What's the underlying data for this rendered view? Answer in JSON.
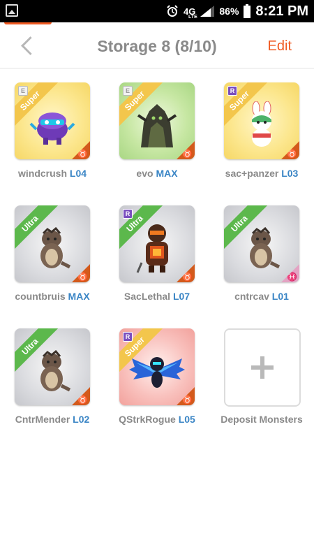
{
  "status_bar": {
    "network": "4G",
    "network_sub": "LTE",
    "battery": "86%",
    "time": "8:21 PM"
  },
  "header": {
    "title": "Storage 8 (8/10)",
    "edit_label": "Edit"
  },
  "monsters": [
    {
      "name": "windcrush",
      "level": "L04",
      "rarity": "Super",
      "badge": "E",
      "element": "♉",
      "bg_color": "#f6d766"
    },
    {
      "name": "evo",
      "level": "MAX",
      "rarity": "Super",
      "badge": "E",
      "element": "♉",
      "bg_color": "#a9d784"
    },
    {
      "name": "sac+panzer",
      "level": "L03",
      "rarity": "Super",
      "badge": "R",
      "element": "♉",
      "bg_color": "#f6d766"
    },
    {
      "name": "countbruis",
      "level": "MAX",
      "rarity": "Ultra",
      "badge": "",
      "element": "♉",
      "bg_color": "#c6c7cc"
    },
    {
      "name": "SacLethal",
      "level": "L07",
      "rarity": "Ultra",
      "badge": "R",
      "element": "♉",
      "bg_color": "#c6c7cc"
    },
    {
      "name": "cntrcav",
      "level": "L01",
      "rarity": "Ultra",
      "badge": "",
      "element": "♓",
      "bg_color": "#c6c7cc"
    },
    {
      "name": "CntrMender",
      "level": "L02",
      "rarity": "Ultra",
      "badge": "",
      "element": "♉",
      "bg_color": "#c6c7cc"
    },
    {
      "name": "QStrkRogue",
      "level": "L05",
      "rarity": "Super",
      "badge": "R",
      "element": "♉",
      "bg_color": "#f2a19c"
    }
  ],
  "deposit": {
    "label": "Deposit Monsters",
    "icon": "plus-icon"
  },
  "colors": {
    "accent": "#f05a22",
    "level_blue": "#3a85c5",
    "super_ribbon": "#f3c64c",
    "ultra_ribbon": "#5cb84c"
  }
}
